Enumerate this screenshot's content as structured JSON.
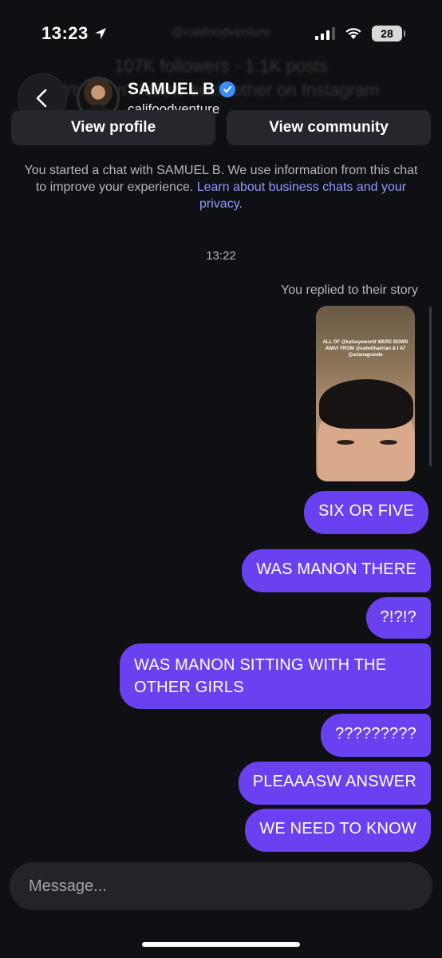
{
  "status_bar": {
    "time": "13:23",
    "battery": "28"
  },
  "background_faded": {
    "line1": "@califoodventure",
    "line2": "107K followers · 1.1K posts",
    "line3": "You don't follow each other on Instagram"
  },
  "header": {
    "name": "SAMUEL B",
    "handle": "califoodventure",
    "verified": true
  },
  "actions": {
    "view_profile": "View profile",
    "view_community": "View community"
  },
  "chat_info": {
    "text": "You started a chat with SAMUEL B. We use information from this chat to improve your experience. ",
    "link": "Learn about business chats and your privacy",
    "end": "."
  },
  "timestamp": "13:22",
  "reply_note": "You replied to their story",
  "story": {
    "caption": "ALL OF @katseyeworld WERE BOWS AWAY FROM @eatwithadrian & I AT @arianagrande"
  },
  "messages": [
    "SIX OR FIVE",
    "WAS MANON THERE",
    "?!?!?",
    "WAS MANON SITTING WITH THE OTHER GIRLS",
    "?????????",
    "PLEAAASW ANSWER",
    "WE NEED TO KNOW"
  ],
  "composer": {
    "placeholder": "Message..."
  },
  "colors": {
    "background": "#0f1013",
    "bubble": "#6a41f0",
    "link": "#8f9bff",
    "verified": "#3a8dff"
  },
  "icons": [
    "location-arrow-icon",
    "signal-icon",
    "wifi-icon",
    "battery-icon",
    "back-chevron-icon",
    "verified-badge-icon"
  ]
}
